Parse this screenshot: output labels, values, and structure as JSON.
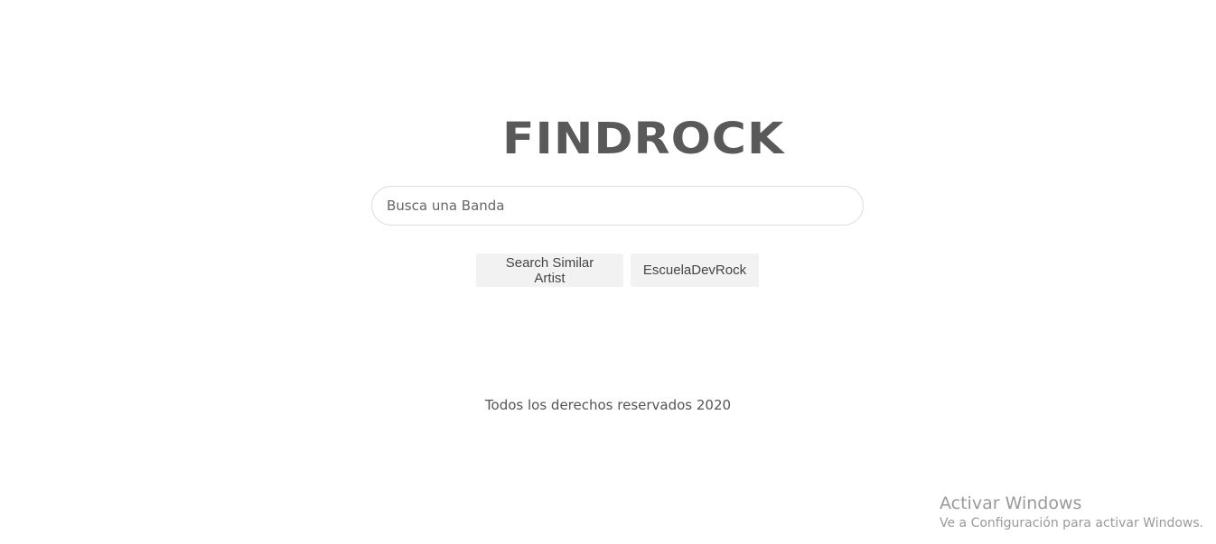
{
  "header": {
    "logo_text": "FINDROCK"
  },
  "search": {
    "placeholder": "Busca una Banda",
    "value": ""
  },
  "actions": {
    "search_similar_label": "Search Similar Artist",
    "escuela_label": "EscuelaDevRock"
  },
  "footer": {
    "text": "Todos los derechos reservados 2020"
  },
  "os_watermark": {
    "title": "Activar Windows",
    "subtitle": "Ve a Configuración para activar Windows."
  },
  "colors": {
    "logo": "#595959",
    "button_bg": "#f2f2f2",
    "input_border": "#dcdcdc",
    "watermark": "#9a9a9a"
  }
}
